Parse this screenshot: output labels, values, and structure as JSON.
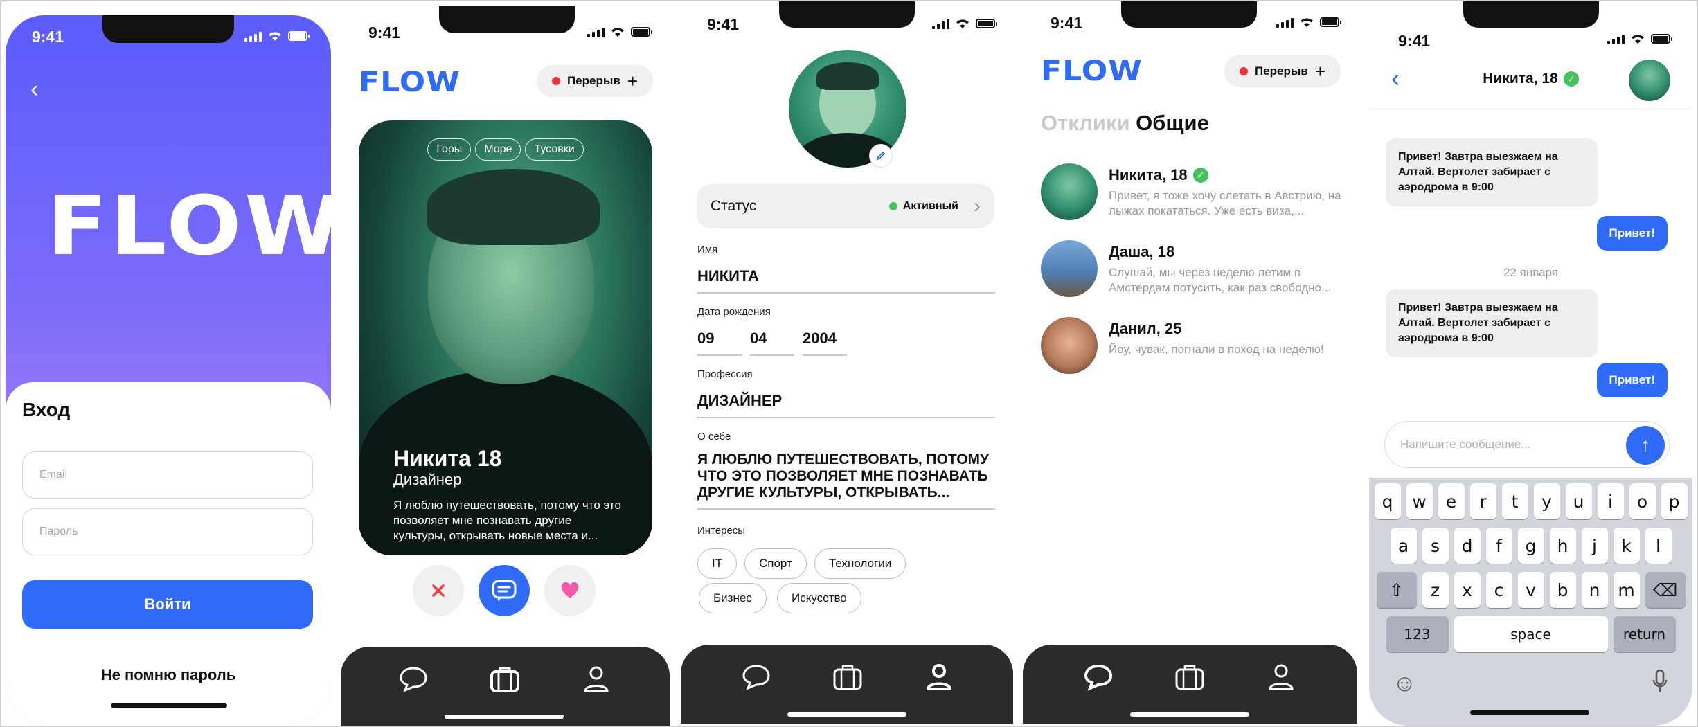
{
  "status_time": "9:41",
  "screen_login": {
    "logo": "FLOW",
    "title": "Вход",
    "email_placeholder": "Email",
    "password_placeholder": "Пароль",
    "login_button": "Войти",
    "forgot_link": "Не помню пароль"
  },
  "header": {
    "logo": "FLOW",
    "break_label": "Перерыв",
    "plus": "+"
  },
  "screen_card": {
    "tags": [
      "Горы",
      "Море",
      "Тусовки"
    ],
    "name": "Никита 18",
    "job": "Дизайнер",
    "bio": "Я люблю путешествовать, потому что это позволяет мне познавать другие культуры, открывать новые места и..."
  },
  "screen_profile": {
    "status_label": "Статус",
    "status_value": "Активный",
    "name_label": "Имя",
    "name_value": "НИКИТА",
    "birth_label": "Дата рождения",
    "birth_day": "09",
    "birth_month": "04",
    "birth_year": "2004",
    "profession_label": "Профессия",
    "profession_value": "ДИЗАЙНЕР",
    "about_label": "О себе",
    "about_value": "Я ЛЮБЛЮ ПУТЕШЕСТВОВАТЬ, ПОТОМУ ЧТО ЭТО ПОЗВОЛЯЕТ МНЕ ПОЗНАВАТЬ ДРУГИЕ КУЛЬТУРЫ, ОТКРЫВАТЬ...",
    "interests_label": "Интересы",
    "interests": [
      "IT",
      "Спорт",
      "Технологии",
      "Бизнес",
      "Искусство"
    ]
  },
  "screen_chats": {
    "tab_inactive": "Отклики",
    "tab_active": "Общие",
    "chats": [
      {
        "name": "Никита, 18",
        "verified": true,
        "preview": "Привет, я тоже хочу слетать в Австрию, на лыжах покататься. Уже есть виза,..."
      },
      {
        "name": "Даша, 18",
        "verified": false,
        "preview": "Слушай, мы через неделю летим в Амстердам потусить, как раз свободно..."
      },
      {
        "name": "Данил, 25",
        "verified": false,
        "preview": "Йоу, чувак, погнали в поход на неделю!"
      }
    ]
  },
  "screen_chat": {
    "title": "Никита, 18",
    "messages": [
      {
        "dir": "in",
        "text": "Привет! Завтра выезжаем на Алтай. Вертолет забирает с аэродрома в 9:00"
      },
      {
        "dir": "out",
        "text": "Привет!"
      },
      {
        "dir": "in",
        "text": "Привет! Завтра выезжаем на Алтай. Вертолет забирает с аэродрома в 9:00"
      },
      {
        "dir": "out",
        "text": "Привет!"
      }
    ],
    "date_separator": "22 января",
    "composer_placeholder": "Напишите сообщение..."
  },
  "keyboard": {
    "row1": [
      "q",
      "w",
      "e",
      "r",
      "t",
      "y",
      "u",
      "i",
      "o",
      "p"
    ],
    "row2": [
      "a",
      "s",
      "d",
      "f",
      "g",
      "h",
      "j",
      "k",
      "l"
    ],
    "row3": [
      "z",
      "x",
      "c",
      "v",
      "b",
      "n",
      "m"
    ],
    "numbers": "123",
    "space": "space",
    "return": "return"
  },
  "colors": {
    "accent": "#2f6bf6",
    "break_dot": "#f0332f",
    "active_dot": "#43c15a",
    "like": "#f05aa8",
    "tabbar": "#2b2b2b"
  }
}
